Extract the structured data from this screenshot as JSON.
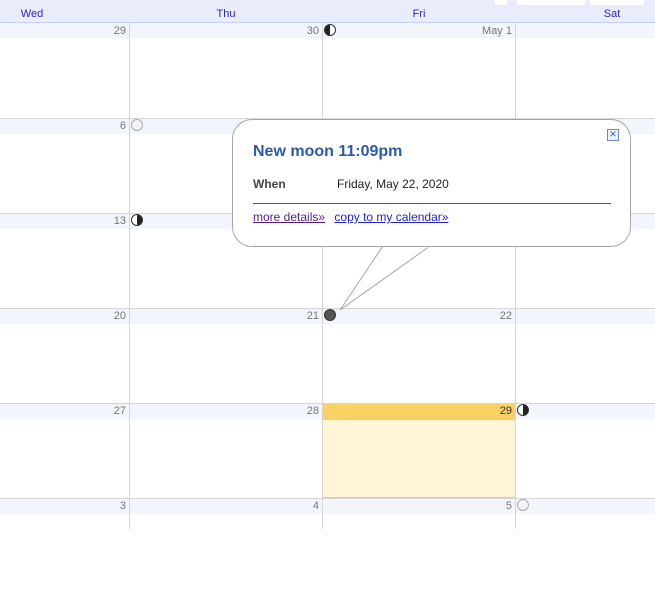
{
  "header": {
    "days": [
      "Wed",
      "Thu",
      "Fri",
      "Sat"
    ]
  },
  "weeks": [
    [
      "29",
      "30",
      "May 1",
      ""
    ],
    [
      "6",
      "",
      "",
      ""
    ],
    [
      "13",
      "",
      "",
      ""
    ],
    [
      "20",
      "21",
      "22",
      ""
    ],
    [
      "27",
      "28",
      "29",
      ""
    ],
    [
      "3",
      "4",
      "5",
      ""
    ]
  ],
  "moons": [
    {
      "cell": "fri-30-left",
      "phase": "last-quarter-icon"
    },
    {
      "cell": "wed-6",
      "phase": "full-moon-icon"
    },
    {
      "cell": "wed-13",
      "phase": "first-quarter-icon"
    },
    {
      "cell": "fri-21",
      "phase": "new-moon-icon"
    },
    {
      "cell": "sat-29",
      "phase": "first-quarter-icon"
    },
    {
      "cell": "sat-5",
      "phase": "full-moon-icon"
    }
  ],
  "popup": {
    "title": "New moon 11:09pm",
    "when_label": "When",
    "when_value": "Friday, May 22, 2020",
    "more_details": "more details»",
    "copy_link": "copy to my calendar»",
    "close_glyph": "✕"
  },
  "colors": {
    "header_bg": "#e8ecfb",
    "header_text": "#2b28b8",
    "highlight_band": "#f9d165",
    "highlight_body": "#fff4d6",
    "popup_title": "#2d5aa0"
  }
}
